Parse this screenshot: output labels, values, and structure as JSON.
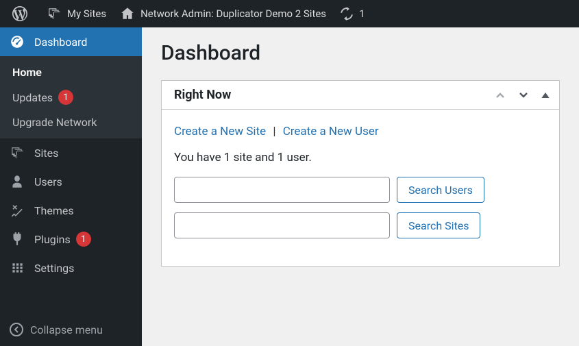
{
  "adminbar": {
    "my_sites": "My Sites",
    "network_admin": "Network Admin: Duplicator Demo 2 Sites",
    "refresh_count": "1"
  },
  "sidebar": {
    "dashboard": "Dashboard",
    "submenu": {
      "home": "Home",
      "updates": "Updates",
      "updates_badge": "1",
      "upgrade_network": "Upgrade Network"
    },
    "sites": "Sites",
    "users": "Users",
    "themes": "Themes",
    "plugins": "Plugins",
    "plugins_badge": "1",
    "settings": "Settings",
    "collapse": "Collapse menu"
  },
  "main": {
    "title": "Dashboard",
    "box": {
      "title": "Right Now",
      "create_site": "Create a New Site",
      "create_user": "Create a New User",
      "summary": "You have 1 site and 1 user.",
      "search_users_btn": "Search Users",
      "search_sites_btn": "Search Sites"
    }
  }
}
